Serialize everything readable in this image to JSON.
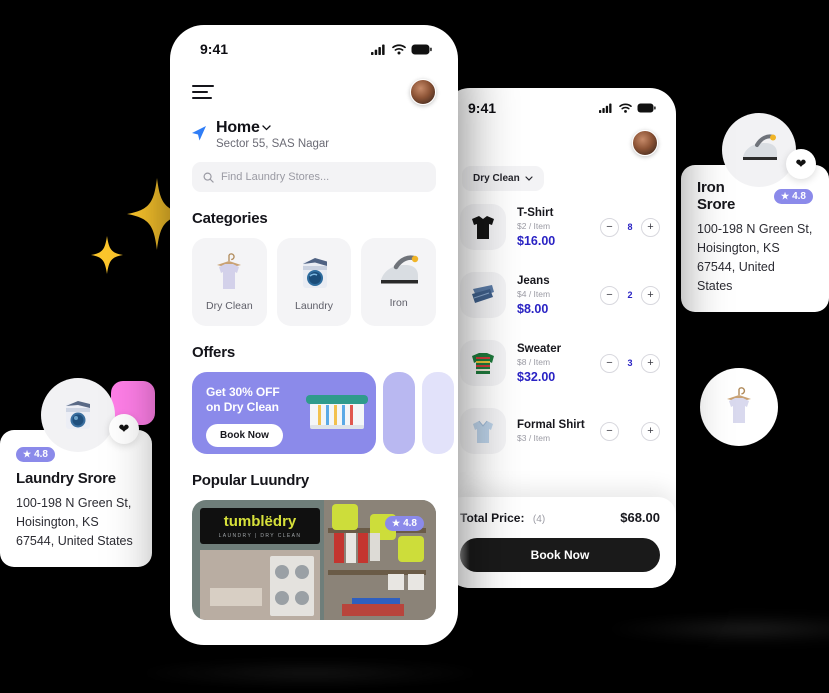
{
  "phone_home": {
    "statusbar": {
      "time": "9:41",
      "icons": [
        "signal-icon",
        "wifi-icon",
        "battery-icon"
      ]
    },
    "menu_icon": "hamburger-menu-icon",
    "avatar": "user-avatar",
    "location": {
      "icon": "location-arrow-icon",
      "title": "Home",
      "chevron": "chevron-down-icon",
      "subtitle": "Sector 55, SAS Nagar"
    },
    "search": {
      "icon": "search-icon",
      "placeholder": "Find Laundry Stores..."
    },
    "categories": {
      "title": "Categories",
      "items": [
        {
          "label": "Dry Clean",
          "icon": "hanging-shirt-icon"
        },
        {
          "label": "Laundry",
          "icon": "washing-machine-icon"
        },
        {
          "label": "Iron",
          "icon": "iron-icon"
        }
      ]
    },
    "offers": {
      "title": "Offers",
      "banner": {
        "line1": "Get 30% OFF",
        "line2": "on Dry Clean",
        "button": "Book Now",
        "image": "laundry-basket-icon",
        "color": "#8b8aea"
      }
    },
    "popular": {
      "title": "Popular Luundry",
      "store": {
        "logo_text": "tumblëdry",
        "logo_sub": "LAUNDRY | DRY CLEAN",
        "rating": "4.8"
      }
    }
  },
  "phone_cart": {
    "statusbar": {
      "time": "9:41"
    },
    "avatar": "user-avatar",
    "filter_chip": {
      "label": "Dry Clean",
      "icon": "chevron-down-icon"
    },
    "items": [
      {
        "name": "T-Shirt",
        "unit": "$2 / Item",
        "price": "$16.00",
        "qty": "8",
        "icon": "tshirt-icon"
      },
      {
        "name": "Jeans",
        "unit": "$4 / Item",
        "price": "$8.00",
        "qty": "2",
        "icon": "jeans-icon"
      },
      {
        "name": "Sweater",
        "unit": "$8 / Item",
        "price": "$32.00",
        "qty": "3",
        "icon": "sweater-icon"
      },
      {
        "name": "Formal Shirt",
        "unit": "$3 / Item",
        "price": "",
        "qty": "",
        "icon": "formal-shirt-icon"
      }
    ],
    "footer": {
      "total_label": "Total Price:",
      "total_count": "(4)",
      "total_amount": "$68.00",
      "book_button": "Book Now"
    }
  },
  "store_card_left": {
    "icon": "washing-machine-icon",
    "favorite_icon": "heart-icon",
    "rating": "4.8",
    "name": "Laundry Srore",
    "address": "100-198 N Green St, Hoisington, KS 67544, United States"
  },
  "store_card_right": {
    "icon": "iron-icon",
    "favorite_icon": "heart-icon",
    "rating": "4.8",
    "name": "Iron Srore",
    "address": "100-198 N Green St, Hoisington, KS 67544, United States"
  },
  "decorations": {
    "sparkle_large": "sparkle-icon",
    "sparkle_small": "sparkle-icon",
    "pink_blob": "pink-blob-shape",
    "floating_shirt": "hanging-shirt-icon"
  },
  "colors": {
    "background": "#000000",
    "accent": "#8b8aea",
    "price": "#2a23c4",
    "sparkle": "#fcc62c",
    "pink": "#ff7fe8"
  }
}
